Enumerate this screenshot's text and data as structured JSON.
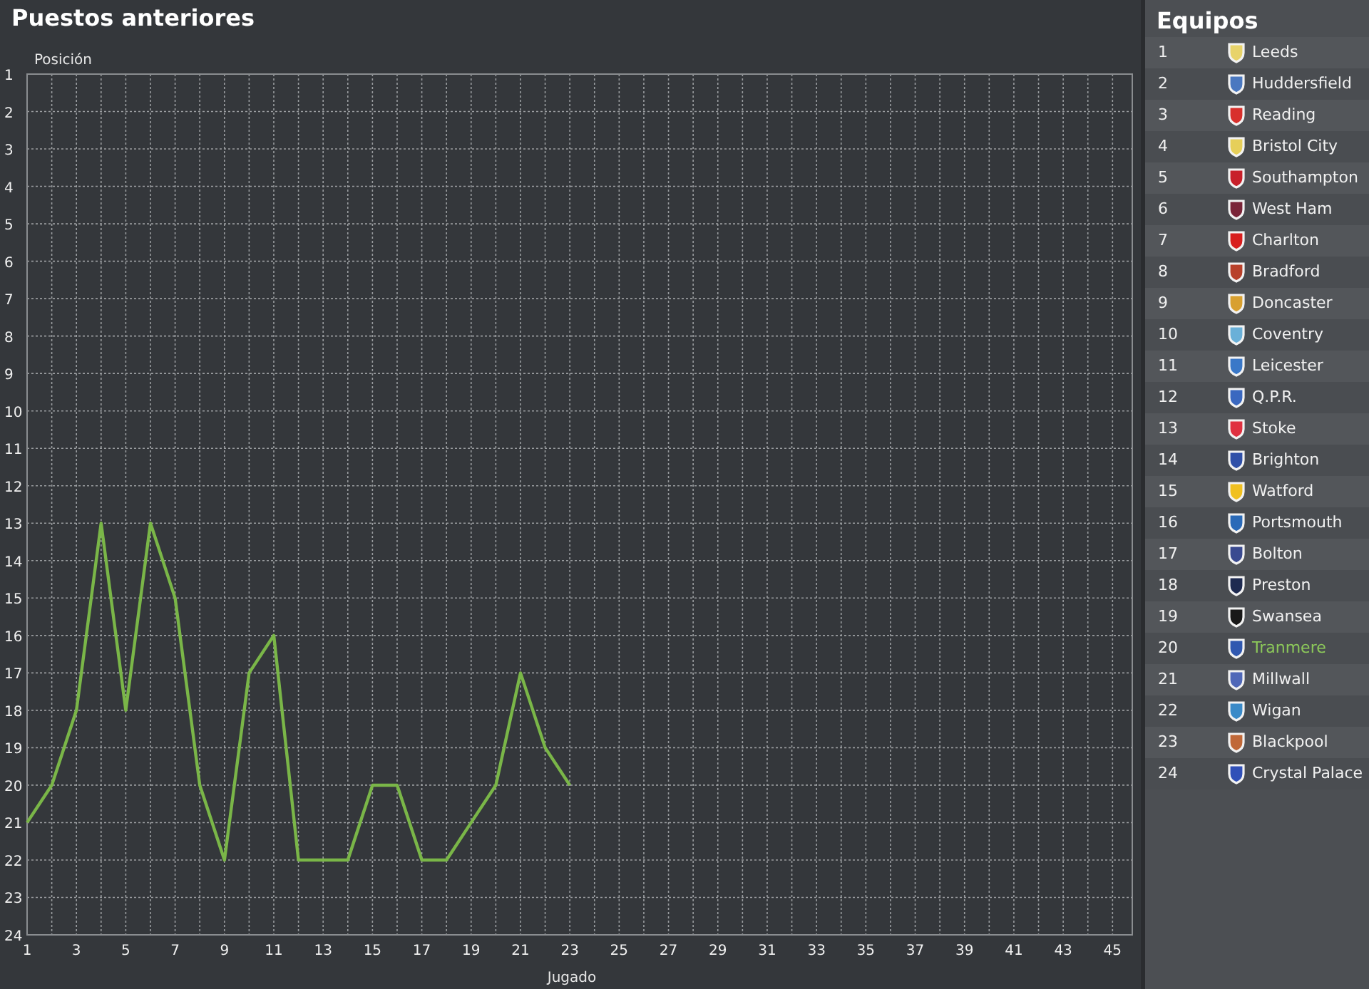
{
  "chart_panel": {
    "title": "Puestos anteriores",
    "chart_data": {
      "type": "line",
      "xlabel": "Jugado",
      "ylabel": "Posición",
      "x": [
        1,
        2,
        3,
        4,
        5,
        6,
        7,
        8,
        9,
        10,
        11,
        12,
        13,
        14,
        15,
        16,
        17,
        18,
        19,
        20,
        21,
        22,
        23
      ],
      "xlim": [
        1,
        45.8
      ],
      "grid": true,
      "ylim": [
        24,
        1
      ],
      "xticks": [
        1,
        3,
        5,
        7,
        9,
        11,
        13,
        15,
        17,
        19,
        21,
        23,
        25,
        27,
        29,
        31,
        33,
        35,
        37,
        39,
        41,
        43,
        45
      ],
      "yticks": [
        1,
        2,
        3,
        4,
        5,
        6,
        7,
        8,
        9,
        10,
        11,
        12,
        13,
        14,
        15,
        16,
        17,
        18,
        19,
        20,
        21,
        22,
        23,
        24
      ],
      "series": [
        {
          "color": "#7ab648",
          "values": [
            21,
            20,
            18,
            13,
            18,
            13,
            15,
            20,
            22,
            17,
            16,
            22,
            22,
            22,
            20,
            20,
            22,
            22,
            21,
            20,
            17,
            19,
            20
          ]
        }
      ]
    }
  },
  "teams_panel": {
    "title": "Equipos",
    "teams": [
      {
        "rank": "1",
        "name": "Leeds",
        "color": "#e8d36a",
        "selected": false
      },
      {
        "rank": "2",
        "name": "Huddersfield",
        "color": "#4a78c0",
        "selected": false
      },
      {
        "rank": "3",
        "name": "Reading",
        "color": "#d8302c",
        "selected": false
      },
      {
        "rank": "4",
        "name": "Bristol City",
        "color": "#e6cf5a",
        "selected": false
      },
      {
        "rank": "5",
        "name": "Southampton",
        "color": "#c8202a",
        "selected": false
      },
      {
        "rank": "6",
        "name": "West Ham",
        "color": "#7a2438",
        "selected": false
      },
      {
        "rank": "7",
        "name": "Charlton",
        "color": "#d81e1e",
        "selected": false
      },
      {
        "rank": "8",
        "name": "Bradford",
        "color": "#b8402a",
        "selected": false
      },
      {
        "rank": "9",
        "name": "Doncaster",
        "color": "#d8a030",
        "selected": false
      },
      {
        "rank": "10",
        "name": "Coventry",
        "color": "#6ab0d8",
        "selected": false
      },
      {
        "rank": "11",
        "name": "Leicester",
        "color": "#3a78c8",
        "selected": false
      },
      {
        "rank": "12",
        "name": "Q.P.R.",
        "color": "#3a68c0",
        "selected": false
      },
      {
        "rank": "13",
        "name": "Stoke",
        "color": "#e03040",
        "selected": false
      },
      {
        "rank": "14",
        "name": "Brighton",
        "color": "#3050a8",
        "selected": false
      },
      {
        "rank": "15",
        "name": "Watford",
        "color": "#f0c020",
        "selected": false
      },
      {
        "rank": "16",
        "name": "Portsmouth",
        "color": "#2a6ab8",
        "selected": false
      },
      {
        "rank": "17",
        "name": "Bolton",
        "color": "#3a4a90",
        "selected": false
      },
      {
        "rank": "18",
        "name": "Preston",
        "color": "#1e2a50",
        "selected": false
      },
      {
        "rank": "19",
        "name": "Swansea",
        "color": "#181818",
        "selected": false
      },
      {
        "rank": "20",
        "name": "Tranmere",
        "color": "#3058b0",
        "selected": true
      },
      {
        "rank": "21",
        "name": "Millwall",
        "color": "#5068b8",
        "selected": false
      },
      {
        "rank": "22",
        "name": "Wigan",
        "color": "#3a8ac8",
        "selected": false
      },
      {
        "rank": "23",
        "name": "Blackpool",
        "color": "#c06838",
        "selected": false
      },
      {
        "rank": "24",
        "name": "Crystal Palace",
        "color": "#3050b8",
        "selected": false
      }
    ]
  }
}
